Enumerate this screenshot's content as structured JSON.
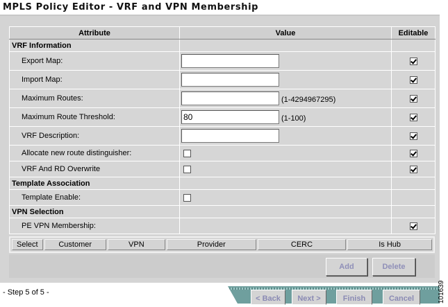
{
  "window": {
    "title": "MPLS Policy Editor - VRF and VPN Membership"
  },
  "table": {
    "headers": {
      "attribute": "Attribute",
      "value": "Value",
      "editable": "Editable"
    },
    "sections": {
      "vrf_info": "VRF Information",
      "template_association": "Template Association",
      "vpn_selection": "VPN Selection"
    },
    "rows": {
      "export_map": {
        "label": "Export Map:",
        "value": "",
        "editable": true
      },
      "import_map": {
        "label": "Import Map:",
        "value": "",
        "editable": true
      },
      "max_routes": {
        "label": "Maximum Routes:",
        "value": "",
        "range": "(1-4294967295)",
        "editable": true
      },
      "max_route_threshold": {
        "label": "Maximum Route Threshold:",
        "value": "80",
        "range": "(1-100)",
        "editable": true
      },
      "vrf_description": {
        "label": "VRF Description:",
        "value": "",
        "editable": true
      },
      "allocate_rd": {
        "label": "Allocate new route distinguisher:",
        "checked": false,
        "editable": true
      },
      "vrf_rd_overwrite": {
        "label": "VRF And RD Overwrite",
        "checked": false,
        "editable": true
      },
      "template_enable": {
        "label": "Template Enable:",
        "checked": false,
        "editable": false
      },
      "pe_vpn_membership": {
        "label": "PE VPN Membership:",
        "editable": true
      }
    }
  },
  "vpn_table": {
    "columns": [
      "Select",
      "Customer",
      "VPN",
      "Provider",
      "CERC",
      "Is Hub"
    ]
  },
  "buttons": {
    "add": "Add",
    "delete": "Delete"
  },
  "wizard": {
    "step": "- Step 5 of 5 -",
    "back": "< Back",
    "next": "Next >",
    "finish": "Finish",
    "cancel": "Cancel"
  },
  "figure_number": "101639"
}
